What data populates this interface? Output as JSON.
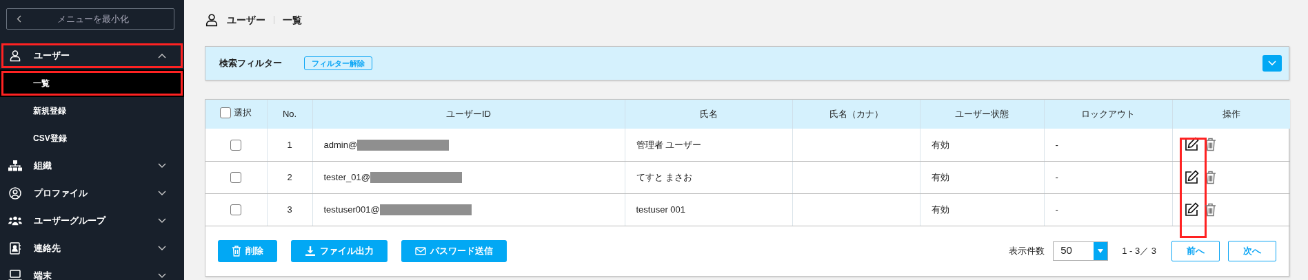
{
  "sidebar": {
    "minimize_label": "メニューを最小化",
    "items": [
      {
        "kind": "user",
        "label": "ユーザー",
        "expanded": true,
        "highlighted": true,
        "children": [
          {
            "label": "一覧",
            "selected": true,
            "highlighted": true
          },
          {
            "label": "新規登録",
            "selected": false,
            "highlighted": false
          },
          {
            "label": "CSV登録",
            "selected": false,
            "highlighted": false
          }
        ]
      },
      {
        "kind": "org",
        "label": "組織",
        "expanded": false,
        "highlighted": false
      },
      {
        "kind": "profile",
        "label": "プロファイル",
        "expanded": false,
        "highlighted": false
      },
      {
        "kind": "group",
        "label": "ユーザーグループ",
        "expanded": false,
        "highlighted": false
      },
      {
        "kind": "contact",
        "label": "連絡先",
        "expanded": false,
        "highlighted": false
      },
      {
        "kind": "device",
        "label": "端末",
        "expanded": false,
        "highlighted": false
      }
    ]
  },
  "breadcrumb": [
    "ユーザー",
    "一覧"
  ],
  "filter": {
    "title": "検索フィルター",
    "clear_label": "フィルター解除",
    "expanded": false
  },
  "table": {
    "select_all": {
      "label": "選択",
      "checked": false
    },
    "columns": [
      "No.",
      "ユーザーID",
      "氏名",
      "氏名（カナ）",
      "ユーザー状態",
      "ロックアウト",
      "操作"
    ],
    "highlight_edit_column": true,
    "rows": [
      {
        "checked": false,
        "no": "1",
        "user_id": "admin@",
        "redacted": true,
        "name": "管理者 ユーザー",
        "status": "有効",
        "lockout": "-"
      },
      {
        "checked": false,
        "no": "2",
        "user_id": "tester_01@",
        "redacted": true,
        "name": "てすと まさお",
        "status": "有効",
        "lockout": "-"
      },
      {
        "checked": false,
        "no": "3",
        "user_id": "testuser001@",
        "redacted": true,
        "name": "testuser 001",
        "status": "有効",
        "lockout": "-"
      }
    ]
  },
  "actions": [
    {
      "kind": "delete",
      "label": "削除"
    },
    {
      "kind": "export",
      "label": "ファイル出力"
    },
    {
      "kind": "send_password",
      "label": "パスワード送信"
    }
  ],
  "pagination": {
    "page_size_label": "表示件数",
    "page_size": "50",
    "range": "1 - 3／ 3",
    "prev": "前へ",
    "next": "次へ"
  }
}
